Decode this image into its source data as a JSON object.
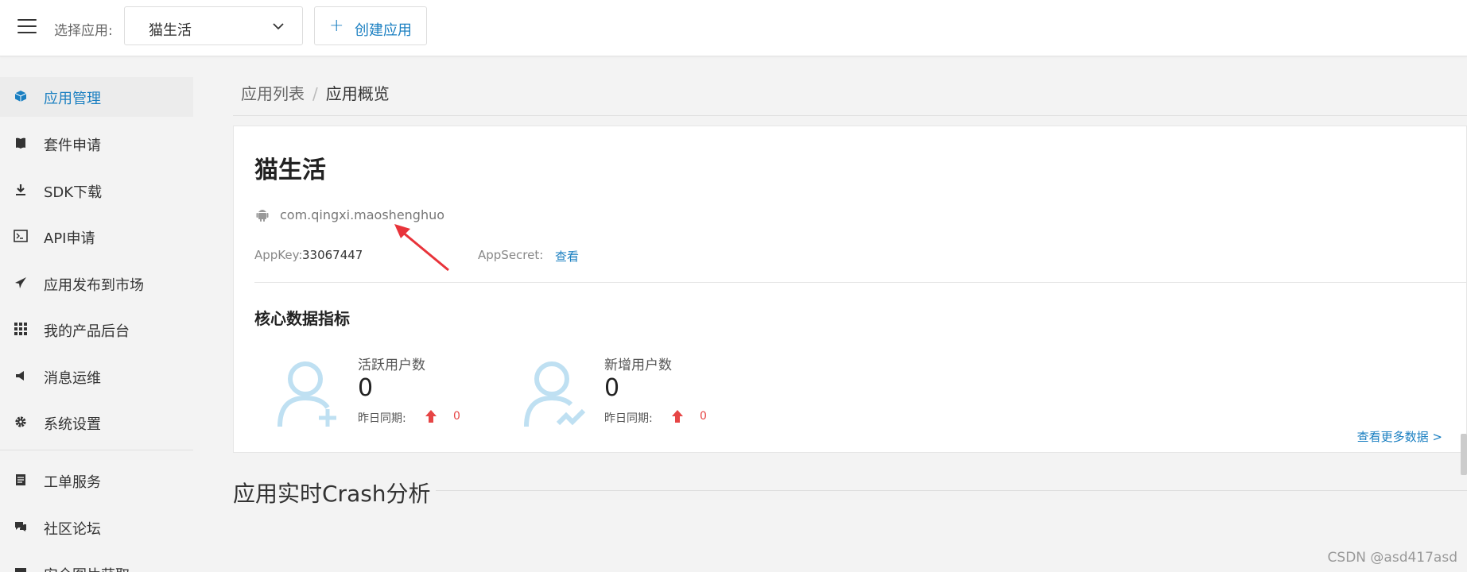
{
  "topbar": {
    "menu_icon": "hamburger-icon",
    "select_label": "选择应用:",
    "selected_app": "猫生活",
    "create_button": "创建应用",
    "create_icon": "plus-icon"
  },
  "sidebar": {
    "items": [
      {
        "label": "应用管理",
        "icon": "cube-icon",
        "active": true
      },
      {
        "label": "套件申请",
        "icon": "book-icon"
      },
      {
        "label": "SDK下载",
        "icon": "download-icon"
      },
      {
        "label": "API申请",
        "icon": "terminal-icon"
      },
      {
        "label": "应用发布到市场",
        "icon": "paper-plane-icon"
      },
      {
        "label": "我的产品后台",
        "icon": "grid-icon"
      },
      {
        "label": "消息运维",
        "icon": "megaphone-icon"
      },
      {
        "label": "系统设置",
        "icon": "gear-icon"
      },
      {
        "label": "工单服务",
        "icon": "document-icon"
      },
      {
        "label": "社区论坛",
        "icon": "chat-icon"
      },
      {
        "label": "安全图片获取",
        "icon": "image-icon"
      }
    ]
  },
  "breadcrumb": {
    "parent": "应用列表",
    "separator": "/",
    "current": "应用概览"
  },
  "app": {
    "name": "猫生活",
    "platform_icon": "android-icon",
    "package": "com.qingxi.maoshenghuo",
    "appkey_label": "AppKey:",
    "appkey": "33067447",
    "appsecret_label": "AppSecret:",
    "appsecret_link": "查看"
  },
  "core_metrics": {
    "title": "核心数据指标",
    "items": [
      {
        "label": "活跃用户数",
        "value": "0",
        "compare_label": "昨日同期:",
        "compare_value": "0",
        "icon": "user-add-icon"
      },
      {
        "label": "新增用户数",
        "value": "0",
        "compare_label": "昨日同期:",
        "compare_value": "0",
        "icon": "user-trend-icon"
      }
    ],
    "more_link": "查看更多数据 >"
  },
  "crash": {
    "title": "应用实时Crash分析"
  },
  "watermark": "CSDN @asd417asd",
  "colors": {
    "accent": "#1a7fc1",
    "annotation": "#e8333a",
    "up_arrow": "#e64545",
    "icon_light": "#bfe0f2"
  }
}
